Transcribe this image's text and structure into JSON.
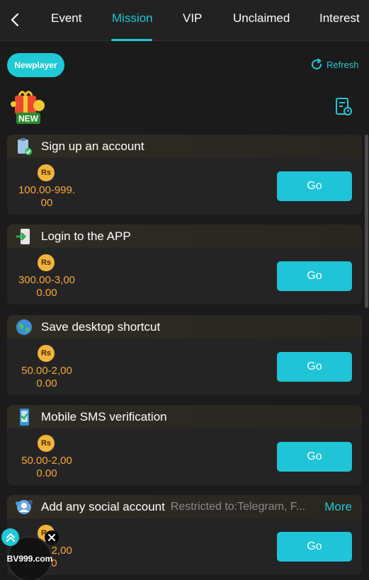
{
  "tabs": [
    {
      "label": "Event"
    },
    {
      "label": "Mission"
    },
    {
      "label": "VIP"
    },
    {
      "label": "Unclaimed"
    },
    {
      "label": "Interest"
    }
  ],
  "active_tab": "Mission",
  "filter_pill": "Newplayer",
  "refresh_label": "Refresh",
  "badge_text": "NEW",
  "currency_symbol": "Rs",
  "go_label": "Go",
  "missions": [
    {
      "title": "Sign up an account",
      "reward_line1": "100.00-999.",
      "reward_line2": "00"
    },
    {
      "title": "Login to the APP",
      "reward_line1": "300.00-3,00",
      "reward_line2": "0.00"
    },
    {
      "title": "Save desktop shortcut",
      "reward_line1": "50.00-2,00",
      "reward_line2": "0.00"
    },
    {
      "title": "Mobile SMS verification",
      "reward_line1": "50.00-2,00",
      "reward_line2": "0.00"
    },
    {
      "title": "Add any social account",
      "restriction": "Restricted to:Telegram, F...",
      "more": "More",
      "reward_line1": "50.00-2,00",
      "reward_line2": "0.00"
    }
  ],
  "floating_logo": "BV999.com",
  "colors": {
    "accent": "#1fc8d8",
    "reward": "#f6a83a",
    "coin": "#f4b43b",
    "card": "#242424"
  }
}
